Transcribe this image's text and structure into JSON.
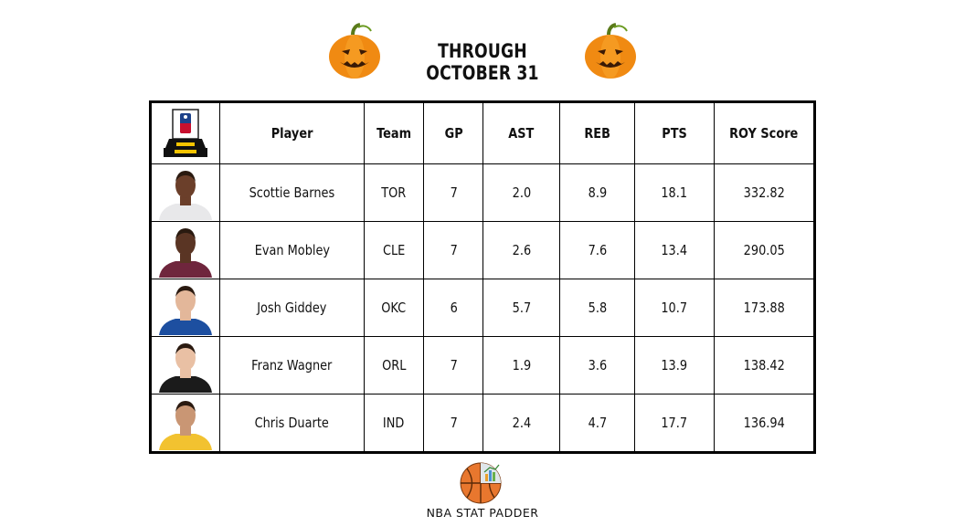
{
  "header": {
    "title": "THROUGH OCTOBER 31"
  },
  "table": {
    "columns": [
      "Player",
      "Team",
      "GP",
      "AST",
      "REB",
      "PTS",
      "ROY Score"
    ],
    "rows": [
      {
        "player": "Scottie Barnes",
        "team": "TOR",
        "gp": "7",
        "ast": "2.0",
        "reb": "8.9",
        "pts": "18.1",
        "score": "332.82",
        "jersey_color": "#e8e8ea",
        "skin_color": "#6b3f2a"
      },
      {
        "player": "Evan Mobley",
        "team": "CLE",
        "gp": "7",
        "ast": "2.6",
        "reb": "7.6",
        "pts": "13.4",
        "score": "290.05",
        "jersey_color": "#6f263d",
        "skin_color": "#5a3524"
      },
      {
        "player": "Josh Giddey",
        "team": "OKC",
        "gp": "6",
        "ast": "5.7",
        "reb": "5.8",
        "pts": "10.7",
        "score": "173.88",
        "jersey_color": "#1d4fa0",
        "skin_color": "#e3b79a"
      },
      {
        "player": "Franz Wagner",
        "team": "ORL",
        "gp": "7",
        "ast": "1.9",
        "reb": "3.6",
        "pts": "13.9",
        "score": "138.42",
        "jersey_color": "#1b1b1b",
        "skin_color": "#e9c0a4"
      },
      {
        "player": "Chris Duarte",
        "team": "IND",
        "gp": "7",
        "ast": "2.4",
        "reb": "4.7",
        "pts": "17.7",
        "score": "136.94",
        "jersey_color": "#f2c230",
        "skin_color": "#c99674"
      }
    ]
  },
  "footer": {
    "brand": "NBA STAT PADDER"
  },
  "icons": {
    "header_decor": "pumpkin-icon",
    "corner": "nba-trophy-icon",
    "logo": "basketball-chart-icon"
  },
  "colors": {
    "pumpkin": "#f08a12",
    "gold": "#f5c400",
    "ball": "#e8772e"
  }
}
